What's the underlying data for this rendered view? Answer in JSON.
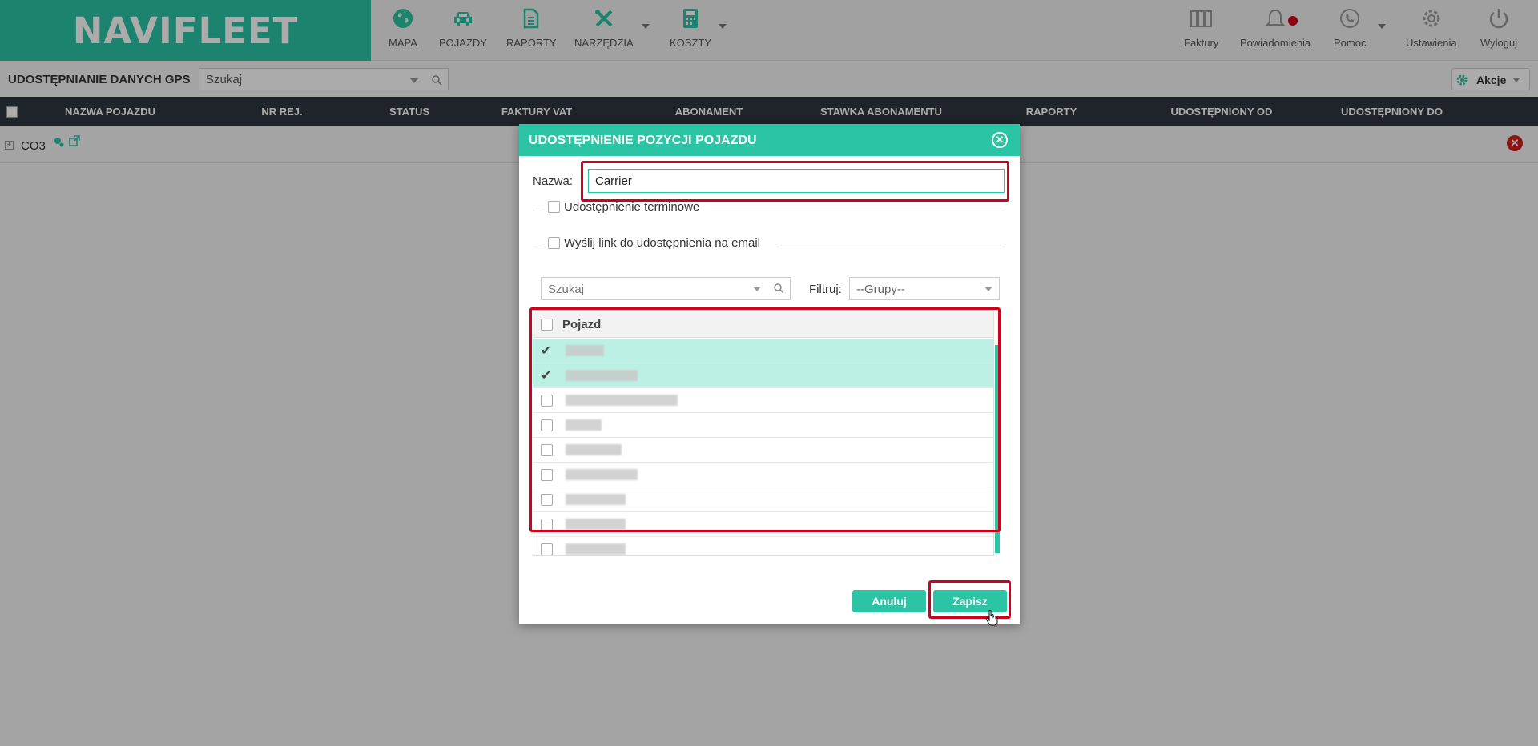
{
  "app": {
    "logo": "NAVIFLEET"
  },
  "nav": [
    {
      "label": "MAPA",
      "icon": "globe-icon"
    },
    {
      "label": "POJAZDY",
      "icon": "car-icon"
    },
    {
      "label": "RAPORTY",
      "icon": "document-icon"
    },
    {
      "label": "NARZĘDZIA",
      "icon": "tools-icon"
    },
    {
      "label": "KOSZTY",
      "icon": "calculator-icon"
    }
  ],
  "nav_right": [
    {
      "label": "Faktury",
      "icon": "binders-icon"
    },
    {
      "label": "Powiadomienia",
      "icon": "bell-icon"
    },
    {
      "label": "Pomoc",
      "icon": "phone-icon"
    },
    {
      "label": "Ustawienia",
      "icon": "gear-icon"
    },
    {
      "label": "Wyloguj",
      "icon": "power-icon"
    }
  ],
  "page": {
    "title": "UDOSTĘPNIANIE DANYCH GPS",
    "search_placeholder": "Szukaj",
    "actions_label": "Akcje"
  },
  "table": {
    "columns": [
      "NAZWA POJAZDU",
      "NR REJ.",
      "STATUS",
      "FAKTURY VAT",
      "ABONAMENT",
      "STAWKA ABONAMENTU",
      "RAPORTY",
      "UDOSTĘPNIONY OD",
      "UDOSTĘPNIONY DO"
    ],
    "group_label": "CO3"
  },
  "modal": {
    "title": "UDOSTĘPNIENIE POZYCJI POJAZDU",
    "name_label": "Nazwa:",
    "name_value": "Carrier",
    "option_terminowe": "Udostępnienie terminowe",
    "option_email": "Wyślij link do udostępnienia na email",
    "search_placeholder": "Szukaj",
    "filter_label": "Filtruj:",
    "filter_value": "--Grupy--",
    "vehicle_column": "Pojazd",
    "rows_selected": [
      true,
      true,
      false,
      false,
      false,
      false,
      false,
      false,
      false
    ],
    "cancel_label": "Anuluj",
    "save_label": "Zapisz"
  },
  "colors": {
    "accent": "#2bc4a4",
    "highlight": "#d0021b",
    "header_dark": "#2f3640"
  }
}
